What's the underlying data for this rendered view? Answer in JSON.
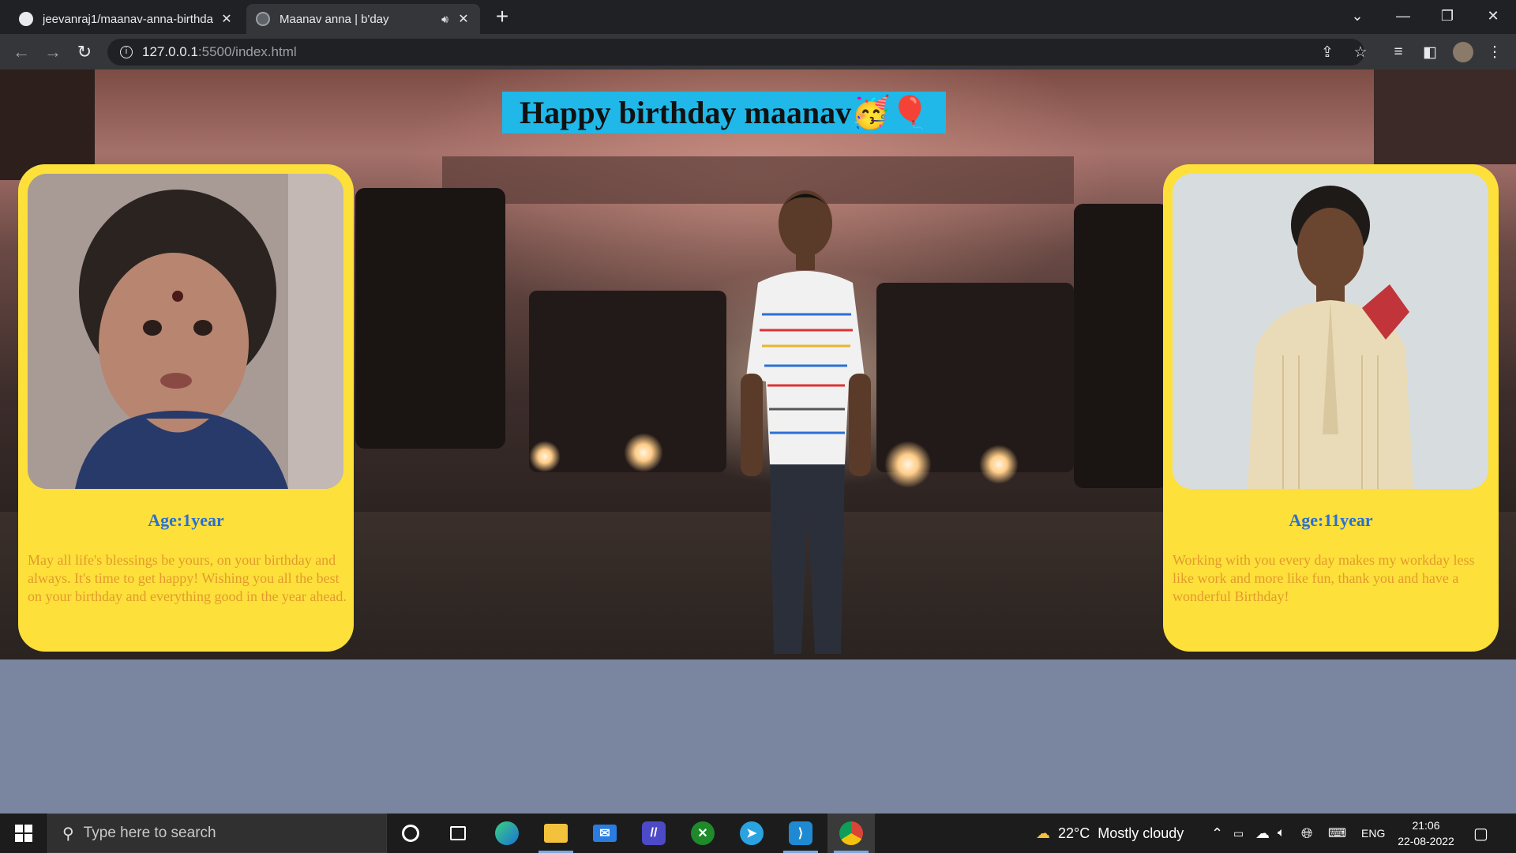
{
  "browser": {
    "tabs": [
      {
        "title": "jeevanraj1/maanav-anna-birthda",
        "favicon": "github-icon",
        "active": false
      },
      {
        "title": "Maanav anna | b'day",
        "favicon": "globe-icon",
        "active": true,
        "audio_icon": "speaker-icon"
      }
    ],
    "address": {
      "host": "127.0.0.1",
      "path": ":5500/index.html"
    }
  },
  "page": {
    "heading": "Happy birthday maanav🥳🎈",
    "left_card": {
      "age": "Age:1year",
      "wish": "May all life's blessings be yours, on your birthday and always. It's time to get happy! Wishing you all the best on your birthday and everything good in the year ahead."
    },
    "right_card": {
      "age": "Age:11year",
      "wish": "Working with you every day makes my workday less like work and more like fun, thank you and have a wonderful Birthday!"
    },
    "colors": {
      "heading_bg": "#1fb8e8",
      "card_bg": "#fde03a",
      "age_text": "#2a6fd6",
      "wish_text": "#e3992e",
      "page_bg": "#7a859f"
    }
  },
  "taskbar": {
    "search_placeholder": "Type here to search",
    "weather": {
      "temp": "22°C",
      "condition": "Mostly cloudy"
    },
    "language": "ENG",
    "time": "21:06",
    "date": "22-08-2022"
  }
}
